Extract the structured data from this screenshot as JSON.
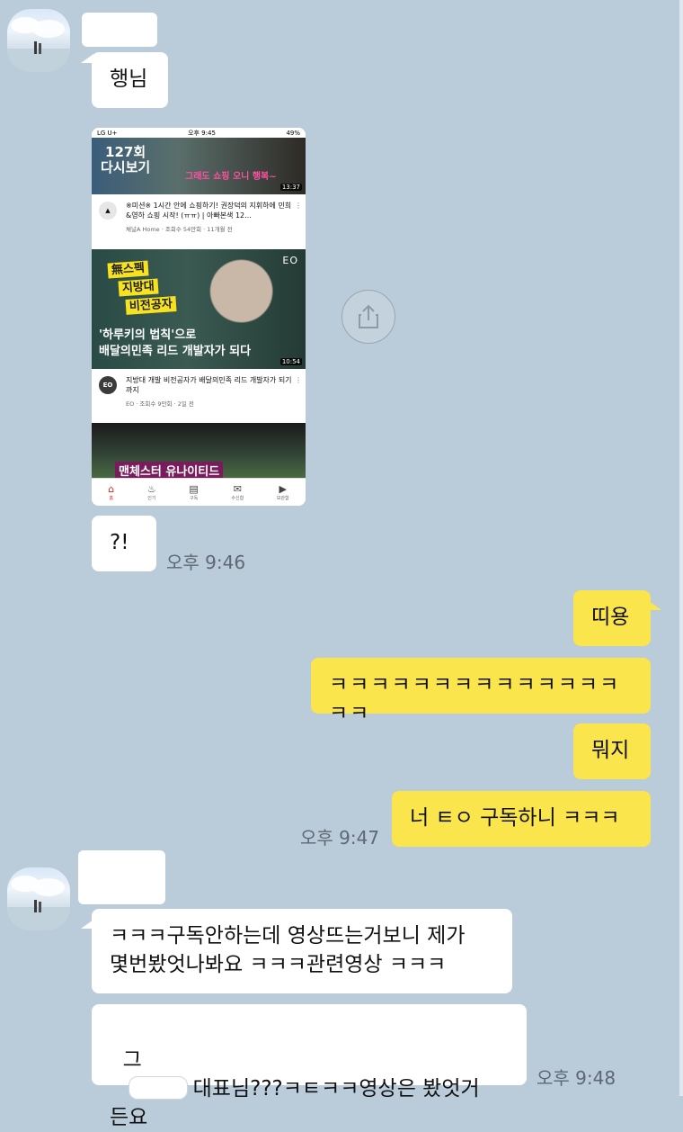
{
  "thread": {
    "first_sender_text": "행님",
    "embedded_screenshot": {
      "status": {
        "carrier": "LG U+",
        "time": "오후 9:45",
        "battery": "49%"
      },
      "video1": {
        "thumb_text": "127회\n다시보기",
        "thumb_pink": "그래도 쇼핑 오니 행복~",
        "duration": "13:37",
        "title": "※미션※ 1시간 안에 쇼핑하기! 권장덕의 지휘하에 민희&영하 쇼핑 시작! (ㅠㅠ) | 아빠본색 12...",
        "meta": "채널A Home · 조회수 54만회 · 11개월 전"
      },
      "video2": {
        "tag1": "無스펙",
        "tag2": "지방대",
        "tag3": "비전공자",
        "eo": "EO",
        "line1": "'하루키의 법칙'으로",
        "line2": "배달의민족 리드 개발자가 되다",
        "duration": "10:54",
        "channel": "EO",
        "title": "지방대 개발 비전공자가 배달의민족 리드 개발자가 되기까지",
        "meta": "EO · 조회수 9만회 · 2일 전"
      },
      "video3": {
        "caption": "맨체스터 유나이티드"
      },
      "tabs": [
        "홈",
        "인기",
        "구독",
        "수신함",
        "보관함"
      ]
    },
    "msg_qm": "?!",
    "time_946": "오후 9:46",
    "me1": "띠용",
    "me2": "ㅋㅋㅋㅋㅋㅋㅋㅋㅋㅋㅋㅋㅋㅋㅋㅋ",
    "me3": "뭐지",
    "me4": "너 ㅌㅇ 구독하니 ㅋㅋㅋ",
    "time_947": "오후 9:47",
    "reply1": "ㅋㅋㅋ구독안하는데 영상뜨는거보니 제가\n몇번봤엇나봐요 ㅋㅋㅋ관련영상 ㅋㅋㅋ",
    "reply2_prefix": "그",
    "reply2_suffix": "대표님???ㅋㅌㅋㅋ영상은 봤엇거\n든요",
    "time_948": "오후 9:48"
  },
  "colors": {
    "background": "#bacbd9",
    "my_bubble": "#fae54d",
    "their_bubble": "#ffffff",
    "yt_red": "#e62117"
  },
  "icons": {
    "share": "share-icon"
  }
}
